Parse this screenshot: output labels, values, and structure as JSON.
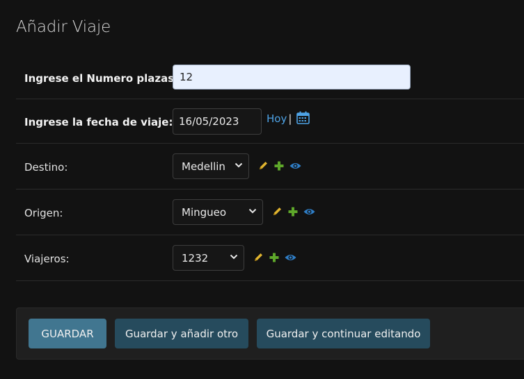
{
  "page": {
    "title": "Añadir Viaje"
  },
  "fields": {
    "plazas": {
      "label": "Ingrese el Numero plazas:",
      "value": "12"
    },
    "fecha": {
      "label": "Ingrese la fecha de viaje:",
      "value": "16/05/2023",
      "today_link": "Hoy",
      "separator": "|",
      "calendar_icon": "calendar-icon"
    },
    "destino": {
      "label": "Destino:",
      "selected": "Medellin"
    },
    "origen": {
      "label": "Origen:",
      "selected": "Mingueo"
    },
    "viajeros": {
      "label": "Viajeros:",
      "selected": "1232"
    }
  },
  "related_icons": {
    "edit": "pencil-icon",
    "add": "plus-icon",
    "view": "eye-icon"
  },
  "colors": {
    "edit": "#e0b42f",
    "add": "#5ea72a",
    "view": "#2f7ec7",
    "primary_button": "#417690",
    "secondary_button": "#264b5d",
    "link": "#4ea3e6"
  },
  "buttons": {
    "save": "GUARDAR",
    "save_add": "Guardar y añadir otro",
    "save_continue": "Guardar y continuar editando"
  }
}
